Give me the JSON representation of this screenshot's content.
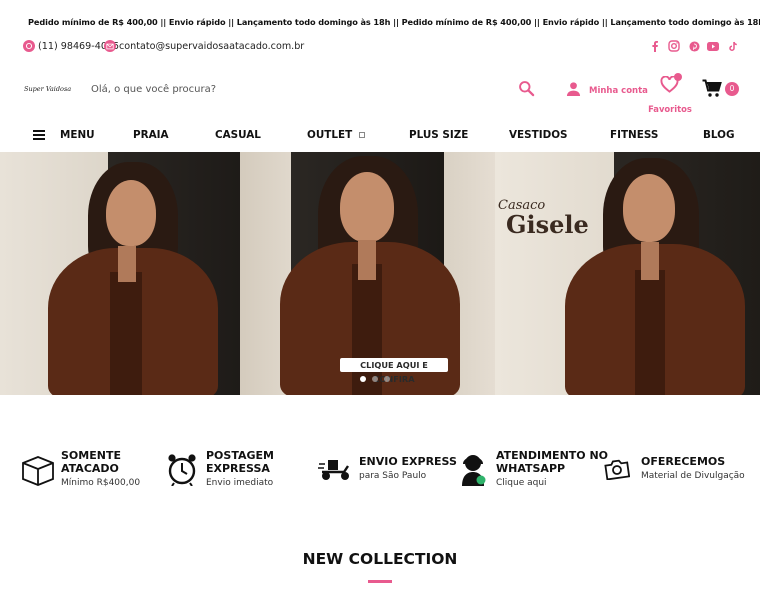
{
  "ticker": {
    "text": "Pedido mínimo de R$ 400,00 || Envio rápido || Lançamento todo domingo às 18h || Pedido mínimo de R$ 400,00 || Envio rápido || Lançamento todo domingo às 18h || Pedido mínimo de R$ 4"
  },
  "contact": {
    "phone": "(11) 98469-4055",
    "email": "contato@supervaidosaatacado.com.br"
  },
  "social": [
    "facebook-icon",
    "instagram-icon",
    "pinterest-icon",
    "youtube-icon",
    "tiktok-icon"
  ],
  "header": {
    "logo": "Super Vaidosa",
    "search_placeholder": "Olá, o que você procura?",
    "account_label": "Minha conta",
    "favorites_label": "Favoritos",
    "cart_count": "0"
  },
  "nav": {
    "menu_label": "MENU",
    "items": [
      "PRAIA",
      "CASUAL",
      "OUTLET",
      "PLUS SIZE",
      "VESTIDOS",
      "FITNESS",
      "BLOG"
    ]
  },
  "hero": {
    "title_small": "Casaco",
    "title_big": "Gisele",
    "cta": "CLIQUE AQUI E CONFIRA",
    "slides": 3,
    "active_slide": 1
  },
  "features": [
    {
      "title": "SOMENTE ATACADO",
      "subtitle": "Mínimo R$400,00",
      "icon": "box-icon"
    },
    {
      "title": "POSTAGEM EXPRESSA",
      "subtitle": "Envio imediato",
      "icon": "alarm-clock-icon"
    },
    {
      "title": "ENVIO EXPRESS",
      "subtitle": "para São Paulo",
      "icon": "delivery-scooter-icon"
    },
    {
      "title": "ATENDIMENTO NO WHATSAPP",
      "subtitle": "Clique aqui",
      "icon": "support-agent-icon"
    },
    {
      "title": "OFERECEMOS",
      "subtitle": "Material de Divulgação",
      "icon": "camera-icon"
    }
  ],
  "section": {
    "title": "NEW COLLECTION"
  },
  "colors": {
    "accent": "#e85a8e"
  }
}
